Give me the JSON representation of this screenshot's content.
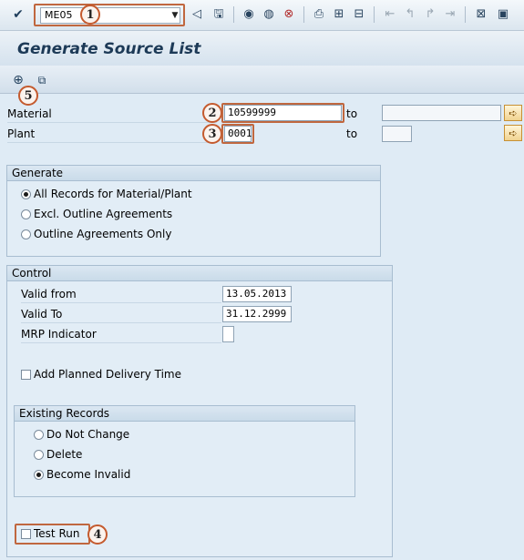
{
  "toolbar": {
    "command_field": "ME05",
    "icons": [
      "enter-icon",
      "back-triangle-icon",
      "save-icon",
      "back-icon",
      "exit-icon",
      "cancel-icon",
      "print-icon",
      "find-icon",
      "find-next-icon",
      "first-page-icon",
      "previous-page-icon",
      "next-page-icon",
      "last-page-icon",
      "create-session-icon",
      "shortcut-icon"
    ]
  },
  "title": "Generate Source List",
  "app_toolbar": {
    "icons": [
      "execute-icon",
      "copy-variant-icon"
    ]
  },
  "selection": {
    "material_label": "Material",
    "material_value": "10599999",
    "plant_label": "Plant",
    "plant_value": "0001",
    "to_label": "to"
  },
  "generate_group": {
    "title": "Generate",
    "options": [
      {
        "label": "All Records for Material/Plant",
        "selected": true
      },
      {
        "label": "Excl. Outline Agreements",
        "selected": false
      },
      {
        "label": "Outline Agreements Only",
        "selected": false
      }
    ]
  },
  "control_group": {
    "title": "Control",
    "valid_from_label": "Valid from",
    "valid_from_value": "13.05.2013",
    "valid_to_label": "Valid To",
    "valid_to_value": "31.12.2999",
    "mrp_label": "MRP Indicator",
    "mrp_value": "",
    "add_delivery_label": "Add Planned Delivery Time",
    "add_delivery_checked": false,
    "existing_records": {
      "title": "Existing Records",
      "options": [
        {
          "label": "Do Not Change",
          "selected": false
        },
        {
          "label": "Delete",
          "selected": false
        },
        {
          "label": "Become Invalid",
          "selected": true
        }
      ]
    },
    "test_run_label": "Test Run",
    "test_run_checked": false
  },
  "markers": [
    "1",
    "2",
    "3",
    "4",
    "5"
  ],
  "colors": {
    "highlight": "#c0673f",
    "background": "#dfebf5",
    "title": "#1d3a57"
  }
}
